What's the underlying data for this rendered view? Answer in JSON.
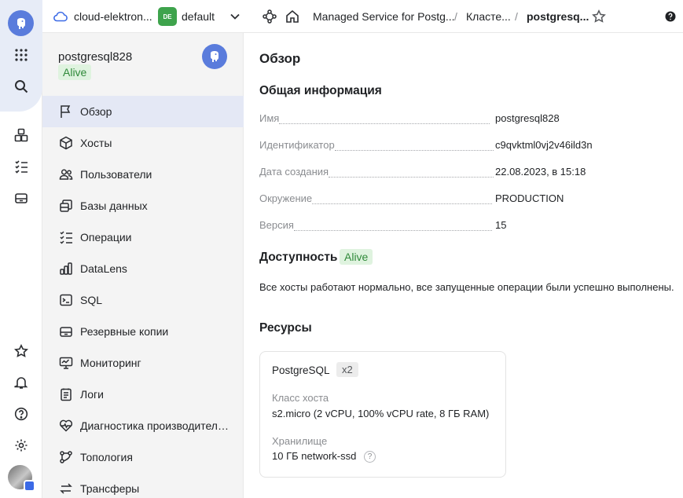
{
  "header": {
    "cloud_name": "cloud-elektron...",
    "folder_badge": "DE",
    "folder_name": "default",
    "breadcrumbs": [
      "Managed Service for Postg...",
      "Класте...",
      "postgresq..."
    ],
    "separator": "/"
  },
  "sidebar": {
    "cluster_name": "postgresql828",
    "status": "Alive",
    "items": [
      {
        "label": "Обзор",
        "icon": "flag-icon",
        "active": true
      },
      {
        "label": "Хосты",
        "icon": "cube-icon"
      },
      {
        "label": "Пользователи",
        "icon": "users-icon"
      },
      {
        "label": "Базы данных",
        "icon": "databases-icon"
      },
      {
        "label": "Операции",
        "icon": "operations-list-icon"
      },
      {
        "label": "DataLens",
        "icon": "bar-chart-icon"
      },
      {
        "label": "SQL",
        "icon": "terminal-icon"
      },
      {
        "label": "Резервные копии",
        "icon": "backup-icon"
      },
      {
        "label": "Мониторинг",
        "icon": "monitor-icon"
      },
      {
        "label": "Логи",
        "icon": "logs-icon"
      },
      {
        "label": "Диагностика производитель...",
        "icon": "heartbeat-icon"
      },
      {
        "label": "Топология",
        "icon": "topology-icon"
      },
      {
        "label": "Трансферы",
        "icon": "transfer-icon"
      }
    ]
  },
  "main": {
    "title": "Обзор",
    "general_title": "Общая информация",
    "info": [
      {
        "key": "Имя",
        "value": "postgresql828"
      },
      {
        "key": "Идентификатор",
        "value": "c9qvktml0vj2v46ild3n"
      },
      {
        "key": "Дата создания",
        "value": "22.08.2023, в 15:18"
      },
      {
        "key": "Окружение",
        "value": "PRODUCTION"
      },
      {
        "key": "Версия",
        "value": "15"
      }
    ],
    "availability_title": "Доступность",
    "availability_status": "Alive",
    "availability_text": "Все хосты работают нормально, все запущенные операции были успешно выполнены.",
    "resources_title": "Ресурсы",
    "resource_card": {
      "title": "PostgreSQL",
      "count": "x2",
      "host_class_label": "Класс хоста",
      "host_class_value": "s2.micro (2 vCPU, 100% vCPU rate, 8 ГБ RAM)",
      "storage_label": "Хранилище",
      "storage_size": "10 ГБ",
      "storage_type": "network-ssd",
      "help": "?"
    }
  },
  "colors": {
    "accent": "#5a7cdc",
    "status_alive_bg": "#dff3df",
    "status_alive_text": "#308a3a",
    "active_nav_bg": "#e4e8f5"
  }
}
